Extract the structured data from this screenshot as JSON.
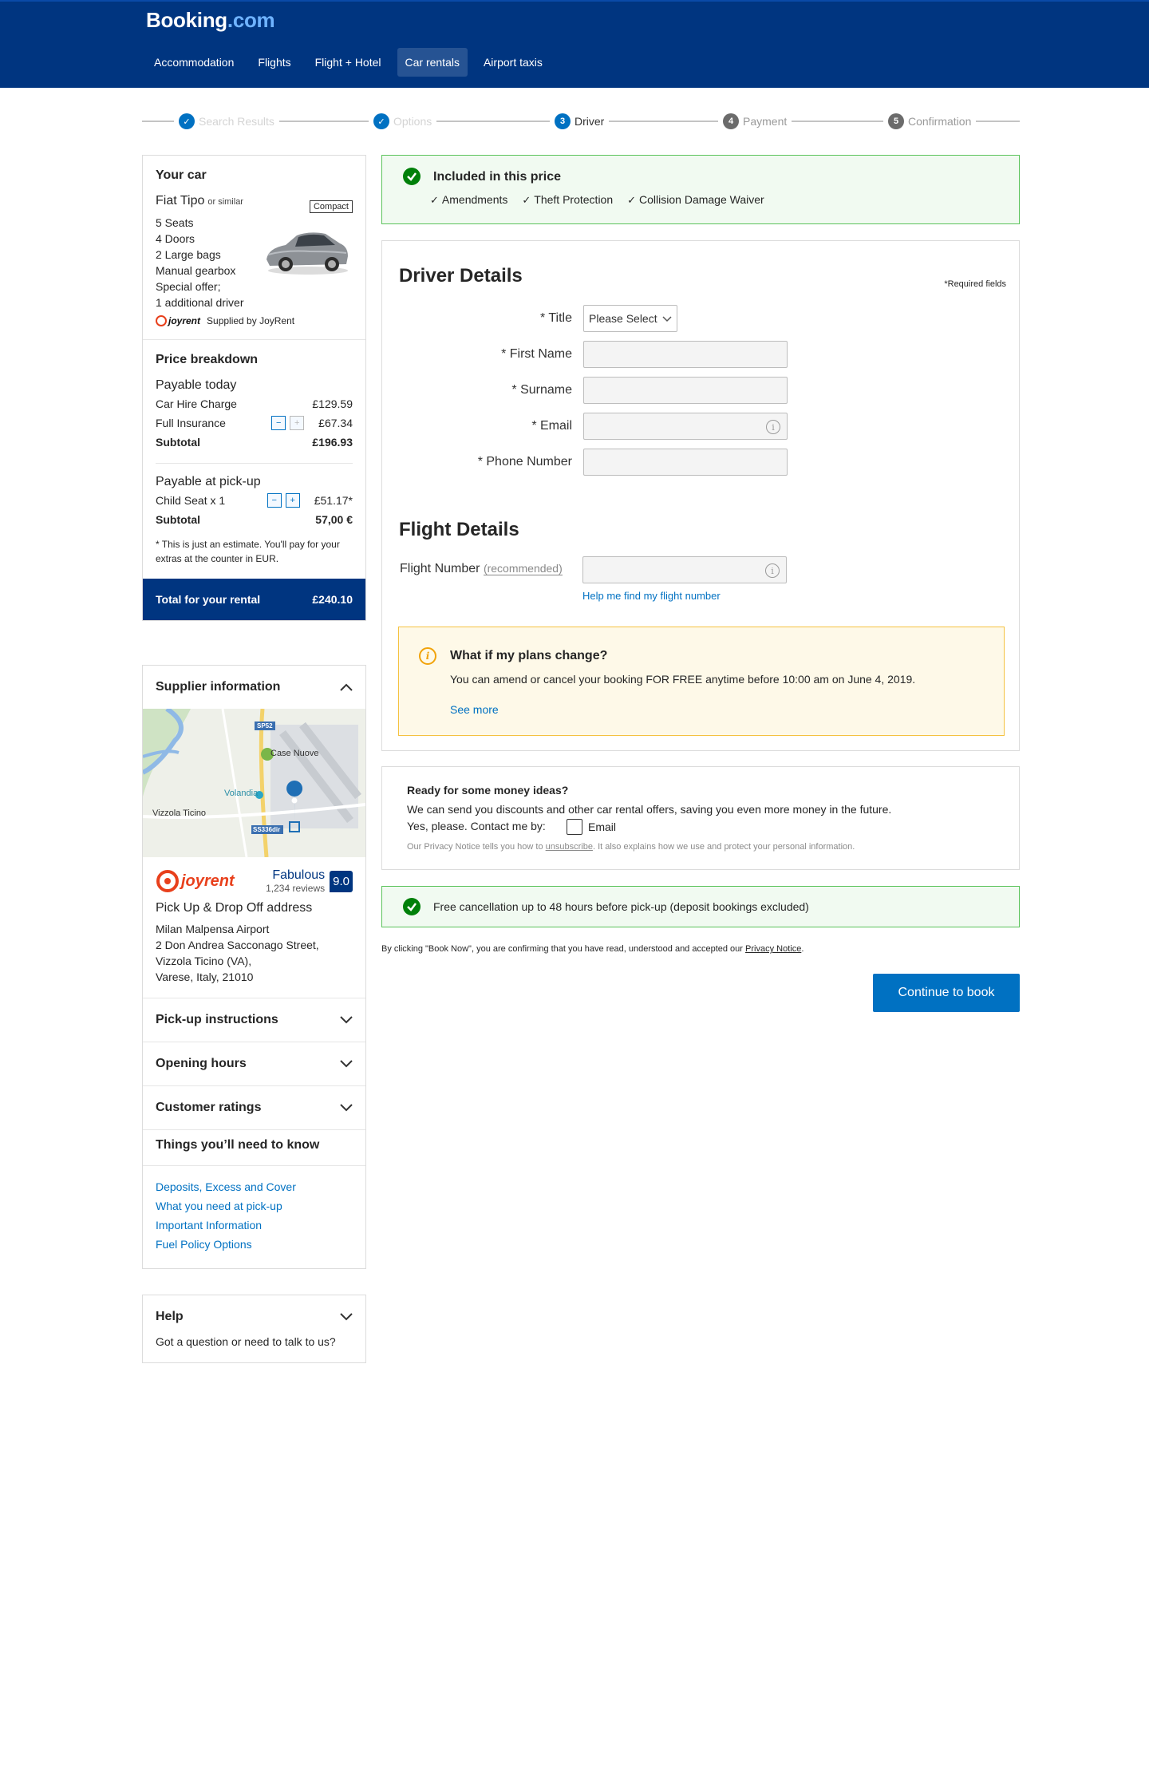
{
  "brand": {
    "logo_main": "Booking",
    "logo_tld": ".com"
  },
  "nav": [
    "Accommodation",
    "Flights",
    "Flight + Hotel",
    "Car rentals",
    "Airport taxis"
  ],
  "steps": [
    {
      "label": "Search Results",
      "number": "✓",
      "state": "done"
    },
    {
      "label": "Options",
      "number": "✓",
      "state": "done"
    },
    {
      "label": "Driver",
      "number": "3",
      "state": "current"
    },
    {
      "label": "Payment",
      "number": "4",
      "state": "todo"
    },
    {
      "label": "Confirmation",
      "number": "5",
      "state": "todo"
    }
  ],
  "car": {
    "section_title": "Your car",
    "name": "Fiat Tipo",
    "similar": "or similar",
    "category": "Compact",
    "features": [
      "5 Seats",
      "4 Doors",
      "2 Large bags",
      "Manual gearbox",
      "Special offer;",
      "1 additional driver"
    ],
    "supplier_logo": "joyrent",
    "supplied_by": "Supplied by JoyRent"
  },
  "price": {
    "section_title": "Price breakdown",
    "today_title": "Payable today",
    "car_hire_label": "Car Hire Charge",
    "car_hire_value": "£129.59",
    "insurance_label": "Full Insurance",
    "insurance_value": "£67.34",
    "subtotal_label": "Subtotal",
    "today_subtotal": "£196.93",
    "pickup_title": "Payable at pick-up",
    "child_seat_label": "Child Seat x 1",
    "child_seat_value": "£51.17*",
    "pickup_subtotal": "57,00 €",
    "estimate_note": "* This is just an estimate. You'll pay for your extras at the counter in EUR.",
    "total_label": "Total for your rental",
    "total_value": "£240.10",
    "minus": "−",
    "plus": "+"
  },
  "supplier": {
    "section_title": "Supplier information",
    "map_labels": {
      "road1": "SP52",
      "town1": "Case Nuove",
      "airport": "Volandia",
      "town2": "Vizzola Ticino",
      "road2": "SS336dir"
    },
    "logo_text": "joyrent",
    "rating_word": "Fabulous",
    "rating_count": "1,234 reviews",
    "score": "9.0",
    "address_title": "Pick Up & Drop Off address",
    "address_lines": [
      "Milan Malpensa Airport",
      "2 Don Andrea Sacconago Street,",
      "Vizzola Ticino (VA),",
      "Varese, Italy, 21010"
    ],
    "pickup_instructions": "Pick-up instructions",
    "opening_hours": "Opening hours",
    "customer_ratings": "Customer ratings",
    "know_title": "Things you’ll need to know",
    "links": [
      "Deposits, Excess and Cover",
      "What you need at pick-up",
      "Important Information",
      "Fuel Policy Options"
    ]
  },
  "help": {
    "title": "Help",
    "text": "Got a question or need to talk to us?"
  },
  "included": {
    "title": "Included in this price",
    "items": [
      "Amendments",
      "Theft Protection",
      "Collision Damage Waiver"
    ]
  },
  "driver": {
    "title": "Driver Details",
    "required_note": "*Required fields",
    "title_label": "* Title",
    "title_placeholder": "Please Select",
    "first_name_label": "* First Name",
    "surname_label": "* Surname",
    "email_label": "* Email",
    "phone_label": "* Phone Number"
  },
  "flight": {
    "title": "Flight Details",
    "label": "Flight Number",
    "recommended": "(recommended)",
    "help_link": "Help me find my flight number"
  },
  "plans": {
    "title": "What if my plans change?",
    "text": "You can amend or cancel your booking FOR FREE anytime before 10:00 am on June 4, 2019.",
    "see_more": "See more"
  },
  "money": {
    "title": "Ready for some money ideas?",
    "text": "We can send you discounts and other car rental offers, saving you even more money in the future.",
    "contact_prefix": "Yes, please. Contact me by:",
    "email_option": "Email",
    "privacy_prefix": "Our Privacy Notice tells you how to ",
    "privacy_link": "unsubscribe",
    "privacy_suffix": ". It also explains how we use and protect your personal information."
  },
  "free_cancel": {
    "text": "Free cancellation up to 48 hours before pick-up (deposit bookings excluded)"
  },
  "legal": {
    "prefix": "By clicking \"Book Now\", you are confirming that you have read, understood and accepted our ",
    "link": "Privacy Notice",
    "suffix": "."
  },
  "cta": {
    "label": "Continue to book"
  },
  "colors": {
    "brand": "#003580",
    "accent": "#0071c2",
    "success": "#008009",
    "warning": "#f1a30a"
  }
}
